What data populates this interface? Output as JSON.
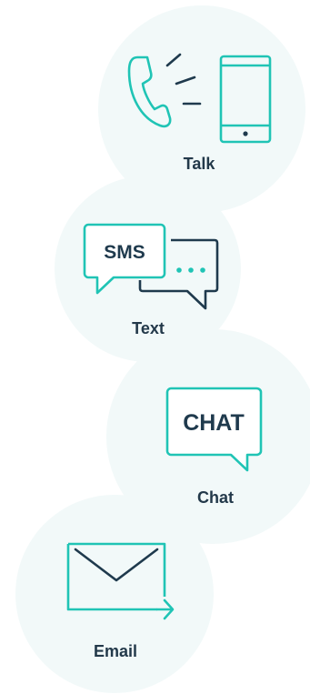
{
  "colors": {
    "circle_fill": "#f2f9f9",
    "teal": "#20c4b5",
    "navy": "#1f3a4d",
    "label": "#23394a"
  },
  "options": [
    {
      "id": "talk",
      "label": "Talk",
      "icons": [
        "phone-handset-icon",
        "sound-waves-icon",
        "mobile-phone-icon"
      ]
    },
    {
      "id": "text",
      "label": "Text",
      "bubble_text": "SMS",
      "bubble_dots": "•••",
      "icons": [
        "sms-bubble-icon",
        "typing-bubble-icon"
      ]
    },
    {
      "id": "chat",
      "label": "Chat",
      "bubble_text": "CHAT",
      "icons": [
        "chat-bubble-icon"
      ]
    },
    {
      "id": "email",
      "label": "Email",
      "icons": [
        "envelope-send-icon"
      ]
    }
  ]
}
